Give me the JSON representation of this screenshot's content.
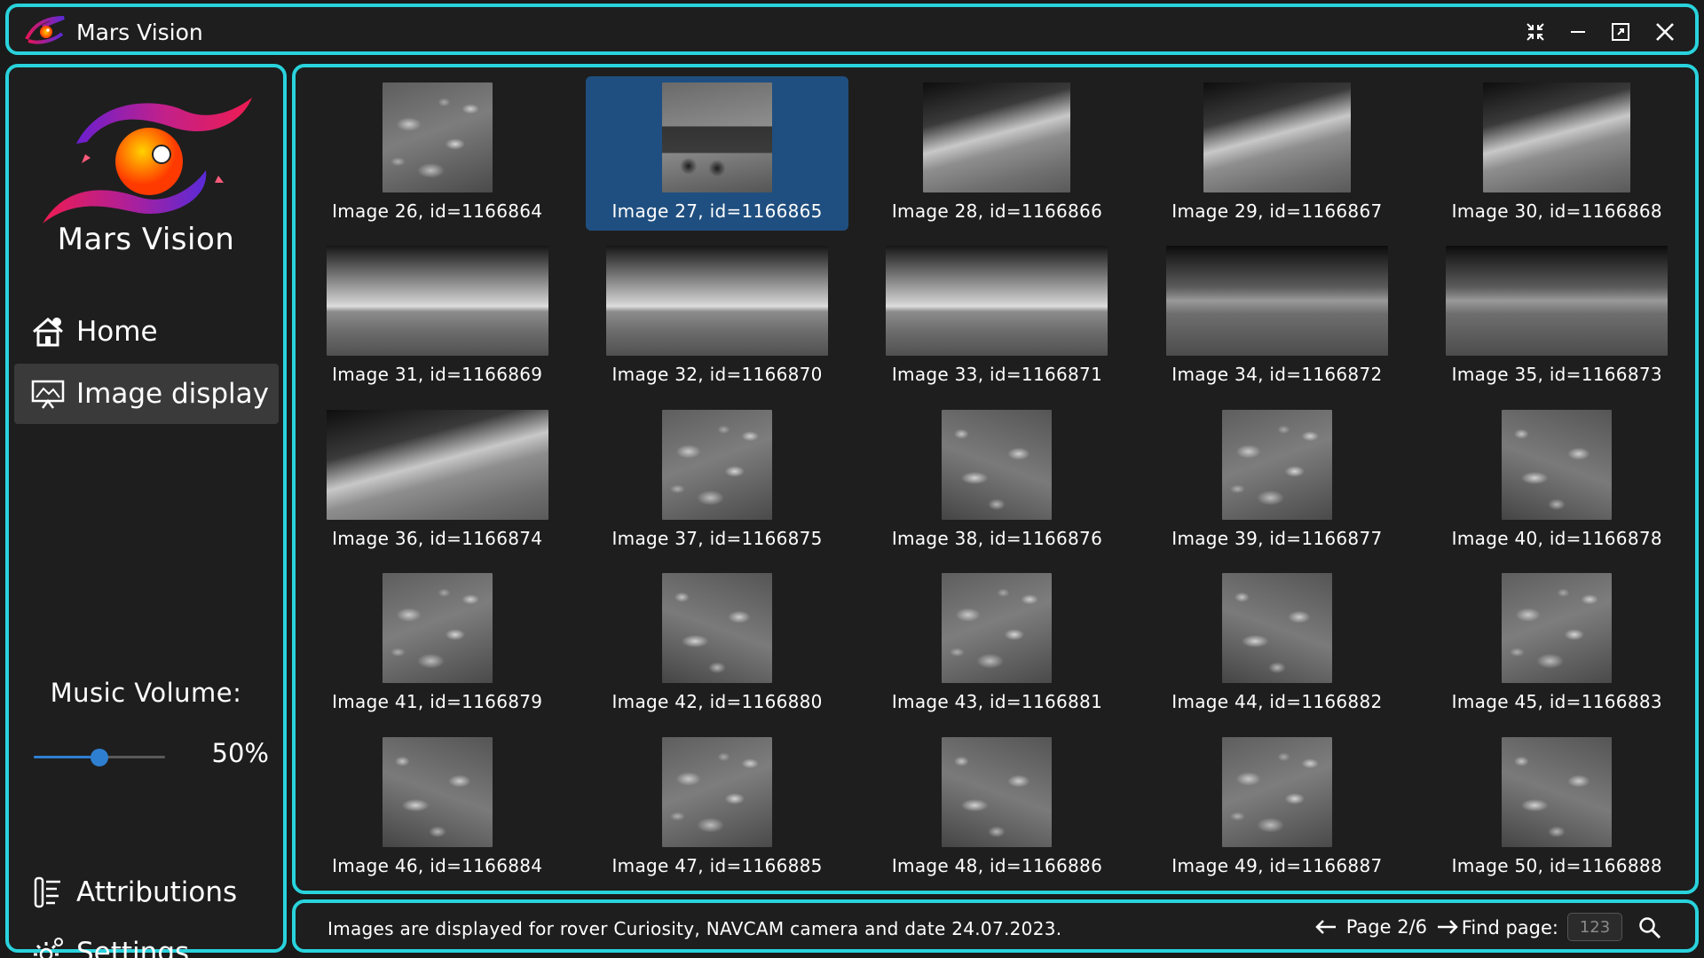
{
  "app": {
    "title": "Mars Vision",
    "brand_name": "Mars Vision"
  },
  "window_controls": [
    "collapse-arrows-icon",
    "minimize-icon",
    "restore-icon",
    "close-icon"
  ],
  "sidebar": {
    "items": [
      {
        "label": "Home",
        "icon": "home-icon",
        "active": false
      },
      {
        "label": "Image display",
        "icon": "image-display-icon",
        "active": true
      }
    ],
    "volume_label": "Music Volume:",
    "volume_value": "50%",
    "volume_fraction": 0.5,
    "bottom_items": [
      {
        "label": "Attributions",
        "icon": "attributions-icon"
      },
      {
        "label": "Settings",
        "icon": "settings-gear-icon"
      }
    ]
  },
  "gallery": {
    "selected_index": 1,
    "images": [
      {
        "label": "Image 26, id=1166864",
        "kind": "rocks"
      },
      {
        "label": "Image 27, id=1166865",
        "kind": "rover"
      },
      {
        "label": "Image 28, id=1166866",
        "kind": "hill"
      },
      {
        "label": "Image 29, id=1166867",
        "kind": "hill"
      },
      {
        "label": "Image 30, id=1166868",
        "kind": "hill"
      },
      {
        "label": "Image 31, id=1166869",
        "kind": "landscape"
      },
      {
        "label": "Image 32, id=1166870",
        "kind": "landscape"
      },
      {
        "label": "Image 33, id=1166871",
        "kind": "landscape"
      },
      {
        "label": "Image 34, id=1166872",
        "kind": "dark"
      },
      {
        "label": "Image 35, id=1166873",
        "kind": "dark"
      },
      {
        "label": "Image 36, id=1166874",
        "kind": "hill-wide"
      },
      {
        "label": "Image 37, id=1166875",
        "kind": "rocks"
      },
      {
        "label": "Image 38, id=1166876",
        "kind": "rocks-alt"
      },
      {
        "label": "Image 39, id=1166877",
        "kind": "rocks"
      },
      {
        "label": "Image 40, id=1166878",
        "kind": "rocks-alt"
      },
      {
        "label": "Image 41, id=1166879",
        "kind": "rocks"
      },
      {
        "label": "Image 42, id=1166880",
        "kind": "rocks-alt"
      },
      {
        "label": "Image 43, id=1166881",
        "kind": "rocks"
      },
      {
        "label": "Image 44, id=1166882",
        "kind": "rocks-alt"
      },
      {
        "label": "Image 45, id=1166883",
        "kind": "rocks"
      },
      {
        "label": "Image 46, id=1166884",
        "kind": "rocks-alt"
      },
      {
        "label": "Image 47, id=1166885",
        "kind": "rocks"
      },
      {
        "label": "Image 48, id=1166886",
        "kind": "rocks-alt"
      },
      {
        "label": "Image 49, id=1166887",
        "kind": "rocks"
      },
      {
        "label": "Image 50, id=1166888",
        "kind": "rocks-alt"
      }
    ]
  },
  "status_bar": {
    "info_text": "Images are displayed for rover Curiosity, NAVCAM camera and date 24.07.2023.",
    "page_label": "Page 2/6",
    "find_page_label": "Find page:",
    "find_page_placeholder": "123"
  },
  "colors": {
    "accent_border": "#29d3dc",
    "selection": "#1f4f80",
    "slider": "#2f7fd1",
    "background": "#1e1e1e"
  }
}
